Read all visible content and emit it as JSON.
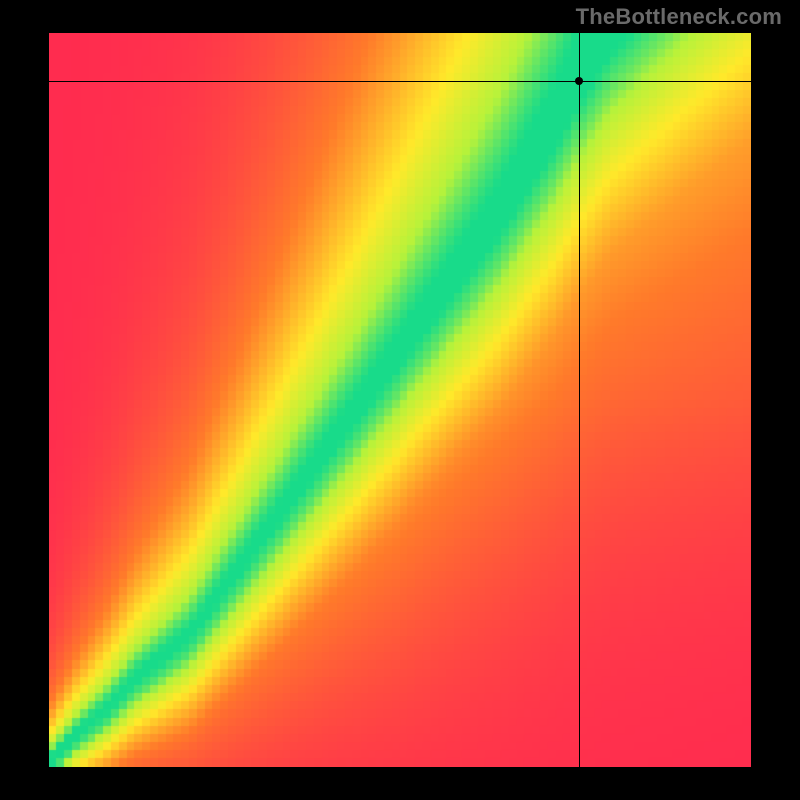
{
  "attribution": "TheBottleneck.com",
  "colors": {
    "background": "#000000",
    "text": "#6a6a6a",
    "crosshair": "#000000",
    "marker": "#000000"
  },
  "chart_data": {
    "type": "heatmap",
    "title": "",
    "xlabel": "",
    "ylabel": "",
    "xlim": [
      0,
      100
    ],
    "ylim": [
      0,
      100
    ],
    "grid": false,
    "legend": false,
    "marker": {
      "x": 75.5,
      "y": 93.5
    },
    "crosshair": {
      "x": 75.5,
      "y": 93.5
    },
    "optimal_curve_comment": "Approximate center of the green band; heatmap value = 1 − distance to this curve (scaled).",
    "optimal_curve": [
      {
        "x": 0,
        "y": 0
      },
      {
        "x": 4,
        "y": 4
      },
      {
        "x": 8,
        "y": 7
      },
      {
        "x": 12,
        "y": 11
      },
      {
        "x": 16,
        "y": 14
      },
      {
        "x": 20,
        "y": 17
      },
      {
        "x": 24,
        "y": 22
      },
      {
        "x": 28,
        "y": 27
      },
      {
        "x": 32,
        "y": 32
      },
      {
        "x": 36,
        "y": 37
      },
      {
        "x": 40,
        "y": 42
      },
      {
        "x": 44,
        "y": 47
      },
      {
        "x": 48,
        "y": 52
      },
      {
        "x": 52,
        "y": 57
      },
      {
        "x": 56,
        "y": 62
      },
      {
        "x": 60,
        "y": 67
      },
      {
        "x": 64,
        "y": 72
      },
      {
        "x": 68,
        "y": 78
      },
      {
        "x": 72,
        "y": 84
      },
      {
        "x": 76,
        "y": 91
      },
      {
        "x": 80,
        "y": 97
      },
      {
        "x": 83,
        "y": 100
      }
    ],
    "band_half_width_comment": "Half-width of green band in y-units; narrower near origin, wider near top.",
    "band_half_width": [
      {
        "x": 0,
        "w": 1.0
      },
      {
        "x": 20,
        "w": 1.8
      },
      {
        "x": 40,
        "w": 2.8
      },
      {
        "x": 60,
        "w": 3.8
      },
      {
        "x": 80,
        "w": 5.0
      },
      {
        "x": 100,
        "w": 6.0
      }
    ],
    "color_scale_comment": "value 0 → red, ~0.45 → orange, ~0.75 → yellow, 1 → green. Pixelated rendering.",
    "color_scale": [
      {
        "v": 0.0,
        "color": "#ff2b4f"
      },
      {
        "v": 0.4,
        "color": "#ff7a2a"
      },
      {
        "v": 0.7,
        "color": "#ffe92a"
      },
      {
        "v": 0.88,
        "color": "#b7f23a"
      },
      {
        "v": 1.0,
        "color": "#18db8a"
      }
    ],
    "pixelation": 90
  }
}
